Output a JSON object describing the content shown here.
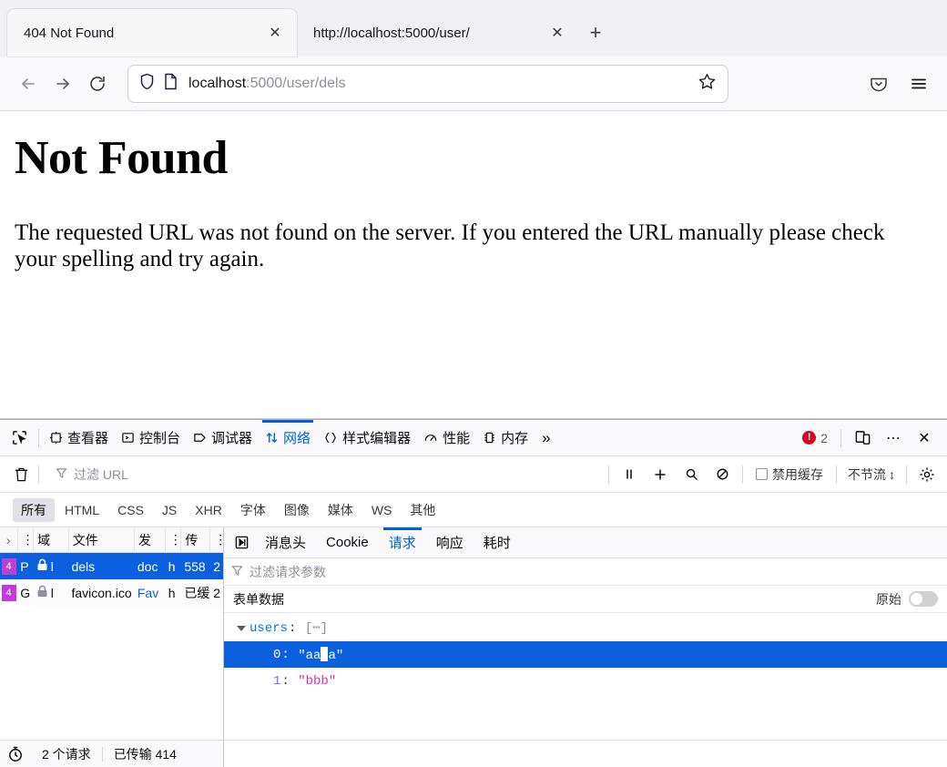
{
  "browser": {
    "tabs": [
      {
        "title": "404 Not Found",
        "active": true,
        "close_label": "✕"
      },
      {
        "title": "http://localhost:5000/user/",
        "active": false,
        "close_label": "✕"
      }
    ],
    "newtab_label": "+",
    "nav": {
      "back_label": "←",
      "forward_label": "→",
      "reload_label": "⟳",
      "url_host": "localhost",
      "url_rest": ":5000/user/dels"
    }
  },
  "page": {
    "heading": "Not Found",
    "body": "The requested URL was not found on the server. If you entered the URL manually please check your spelling and try again."
  },
  "devtools": {
    "tabs": [
      {
        "label": "查看器",
        "active": false
      },
      {
        "label": "控制台",
        "active": false
      },
      {
        "label": "调试器",
        "active": false
      },
      {
        "label": "网络",
        "active": true
      },
      {
        "label": "样式编辑器",
        "active": false
      },
      {
        "label": "性能",
        "active": false
      },
      {
        "label": "内存",
        "active": false
      }
    ],
    "overflow_label": "»",
    "error_count": "2",
    "meatball_label": "⋯",
    "close_label": "✕",
    "accent_color": "#0060df",
    "error_color": "#d70022"
  },
  "network_toolbar": {
    "filter_placeholder": "过滤 URL",
    "disable_cache_label": "禁用缓存",
    "throttle_label": "不节流",
    "throttle_caret": "↕"
  },
  "type_filters": [
    {
      "label": "所有",
      "active": true
    },
    {
      "label": "HTML",
      "active": false
    },
    {
      "label": "CSS",
      "active": false
    },
    {
      "label": "JS",
      "active": false
    },
    {
      "label": "XHR",
      "active": false
    },
    {
      "label": "字体",
      "active": false
    },
    {
      "label": "图像",
      "active": false
    },
    {
      "label": "媒体",
      "active": false
    },
    {
      "label": "WS",
      "active": false
    },
    {
      "label": "其他",
      "active": false
    }
  ],
  "request_list": {
    "columns": [
      "›",
      "⋮",
      "域",
      "文件",
      "发",
      "⋮",
      "传",
      "⋮"
    ],
    "rows": [
      {
        "status": "4",
        "method": "P",
        "lock": "🔒",
        "domain": "l",
        "file": "dels",
        "initiator": "doc",
        "type": "h",
        "transferred": "558",
        "size": "2",
        "selected": true
      },
      {
        "status": "4",
        "method": "G",
        "lock": "🔒",
        "domain": "l",
        "file": "favicon.ico",
        "initiator": "Fav",
        "type": "h",
        "transferred": "已缓",
        "size": "2",
        "selected": false
      }
    ]
  },
  "details": {
    "tabs": [
      {
        "label": "消息头",
        "active": false
      },
      {
        "label": "Cookie",
        "active": false
      },
      {
        "label": "请求",
        "active": true
      },
      {
        "label": "响应",
        "active": false
      },
      {
        "label": "耗时",
        "active": false
      }
    ],
    "filter_placeholder": "过滤请求参数",
    "section_title": "表单数据",
    "raw_label": "原始",
    "raw_on": false,
    "tree": {
      "root_key": "users",
      "root_value": "[⋯]",
      "items": [
        {
          "index": "0",
          "value": "\"aaa\"",
          "selected": true,
          "cursor_after": 2
        },
        {
          "index": "1",
          "value": "\"bbb\"",
          "selected": false
        }
      ]
    }
  },
  "status_bar": {
    "request_count": "2 个请求",
    "transferred": "已传输 414 "
  }
}
